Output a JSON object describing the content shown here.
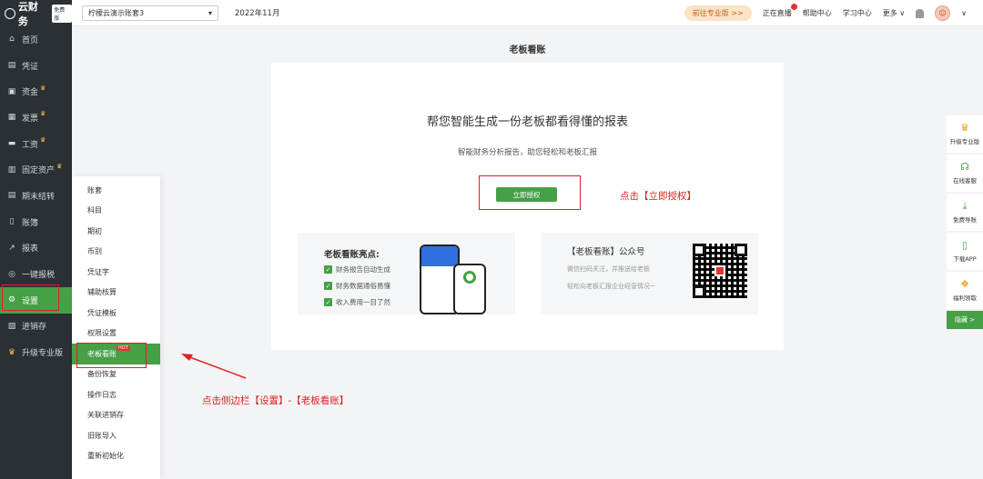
{
  "app": {
    "logo_text": "云财务",
    "logo_badge": "免费版"
  },
  "topbar": {
    "account": "柠檬云演示账套3",
    "period": "2022年11月",
    "pro_button": "前往专业版 >>",
    "live": "正在直播",
    "help": "帮助中心",
    "learn": "学习中心",
    "more": "更多 ∨"
  },
  "sidebar": {
    "items": [
      {
        "label": "首页",
        "icon": "home-icon",
        "glyph": "⌂",
        "crown": false
      },
      {
        "label": "凭证",
        "icon": "voucher-icon",
        "glyph": "▤",
        "crown": false
      },
      {
        "label": "资金",
        "icon": "fund-icon",
        "glyph": "▣",
        "crown": true
      },
      {
        "label": "发票",
        "icon": "invoice-icon",
        "glyph": "▦",
        "crown": true
      },
      {
        "label": "工资",
        "icon": "salary-icon",
        "glyph": "▬",
        "crown": true
      },
      {
        "label": "固定资产",
        "icon": "asset-icon",
        "glyph": "▥",
        "crown": true
      },
      {
        "label": "期末结转",
        "icon": "closing-icon",
        "glyph": "▤",
        "crown": false
      },
      {
        "label": "账簿",
        "icon": "ledger-icon",
        "glyph": "▯",
        "crown": false
      },
      {
        "label": "报表",
        "icon": "report-icon",
        "glyph": "↗",
        "crown": false
      },
      {
        "label": "一键报税",
        "icon": "tax-icon",
        "glyph": "◎",
        "crown": false
      },
      {
        "label": "设置",
        "icon": "gear-icon",
        "glyph": "⚙",
        "crown": false
      },
      {
        "label": "进销存",
        "icon": "inventory-icon",
        "glyph": "▧",
        "crown": false
      },
      {
        "label": "升级专业版",
        "icon": "crown-icon",
        "glyph": "♛",
        "crown": false
      }
    ]
  },
  "submenu": {
    "items": [
      "账套",
      "科目",
      "期初",
      "币别",
      "凭证字",
      "辅助核算",
      "凭证模板",
      "权限设置",
      "老板看账",
      "备份恢复",
      "操作日志",
      "关联进销存",
      "旧账导入",
      "重新初始化"
    ],
    "hot_badge": "HOT"
  },
  "main": {
    "page_title": "老板看账",
    "headline": "帮您智能生成一份老板都看得懂的报表",
    "subline": "智能财务分析报告，助您轻松和老板汇报",
    "auth_button": "立即授权",
    "left_panel": {
      "title": "老板看账亮点:",
      "points": [
        "财务报告自动生成",
        "财务数据通俗易懂",
        "收入费用一目了然"
      ]
    },
    "right_panel": {
      "title": "【老板看账】公众号",
      "line1": "微信扫码关注，并推送给老板",
      "line2": "轻松向老板汇报企业经营情况~"
    }
  },
  "annotations": {
    "click_auth": "点击【立即授权】",
    "click_side": "点击侧边栏【设置】-【老板看账】"
  },
  "right_tools": [
    {
      "label": "升级专业版",
      "icon": "crown-icon",
      "glyph": "♛",
      "color": "#f0a020"
    },
    {
      "label": "在线客服",
      "icon": "headset-icon",
      "glyph": "☊",
      "color": "#46a046"
    },
    {
      "label": "免费导账",
      "icon": "download-icon",
      "glyph": "⤓",
      "color": "#46a046"
    },
    {
      "label": "下载APP",
      "icon": "phone-icon",
      "glyph": "▯",
      "color": "#46a046"
    },
    {
      "label": "福利领取",
      "icon": "gift-icon",
      "glyph": "❖",
      "color": "#f0a020"
    }
  ],
  "hide_label": "隐藏 >",
  "colors": {
    "sidebar_bg": "#2b3035",
    "accent_green": "#46a046",
    "annotation_red": "#e02020"
  }
}
